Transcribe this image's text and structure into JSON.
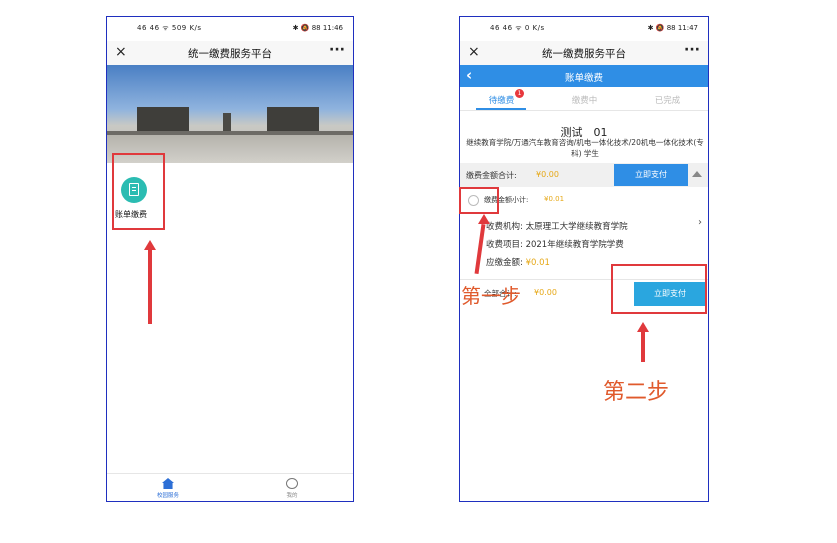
{
  "left_phone": {
    "status": {
      "left": "46 46 ᯤ 509 K/s",
      "right": "✱ 🔕 88 11:46"
    },
    "header": {
      "title": "统一缴费服务平台",
      "close": "×",
      "more": "···"
    },
    "app_icon_label": "账单缴费",
    "tabbar": {
      "home": "校园服务",
      "me": "我的"
    }
  },
  "right_phone": {
    "status": {
      "left": "46 46 ᯤ 0 K/s",
      "right": "✱ 🔕 88 11:47"
    },
    "header": {
      "title": "统一缴费服务平台",
      "close": "×",
      "more": "···"
    },
    "page_title": "账单缴费",
    "tabs": [
      {
        "label": "待缴费",
        "badge": "1"
      },
      {
        "label": "缴费中"
      },
      {
        "label": "已完成"
      }
    ],
    "student": {
      "name": "测试　01",
      "department": "继续教育学院/万通汽车教育咨询/机电一体化技术/20机电一体化技术(专科) 学生"
    },
    "total": {
      "label": "缴费金额合计:",
      "amount": "¥0.00",
      "pay_button": "立即支付"
    },
    "subtotal": {
      "label": "缴费金额小计:",
      "amount": "¥0.01"
    },
    "details": {
      "institution_label": "收费机构:",
      "institution": "太原理工大学继续教育学院",
      "item_label": "收费项目:",
      "item": "2021年继续教育学院学费",
      "due_label": "应缴金额:",
      "due": "¥0.01"
    },
    "bottom": {
      "label": "全部合计:",
      "amount": "¥0.00",
      "pay_button": "立即支付"
    }
  },
  "annotations": {
    "step1": "第一步",
    "step2": "第二步"
  },
  "colors": {
    "accent_blue": "#2f8ee5",
    "annotation_red": "#e0393c",
    "amount_orange": "#e6a817",
    "teal": "#2bbcb2"
  }
}
